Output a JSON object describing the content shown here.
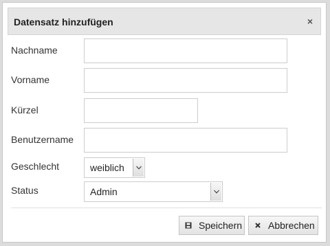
{
  "dialog": {
    "title": "Datensatz hinzufügen",
    "close_symbol": "×"
  },
  "form": {
    "nachname": {
      "label": "Nachname",
      "value": ""
    },
    "vorname": {
      "label": "Vorname",
      "value": ""
    },
    "kuerzel": {
      "label": "Kürzel",
      "value": ""
    },
    "benutzername": {
      "label": "Benutzername",
      "value": ""
    },
    "geschlecht": {
      "label": "Geschlecht",
      "selected": "weiblich"
    },
    "status": {
      "label": "Status",
      "selected": "Admin"
    }
  },
  "buttons": {
    "save_label": "Speichern",
    "cancel_label": "Abbrechen"
  },
  "icons": {
    "close": "close-icon",
    "save": "floppy-disk-icon",
    "cancel": "x-icon",
    "dropdown": "chevron-down-icon"
  }
}
